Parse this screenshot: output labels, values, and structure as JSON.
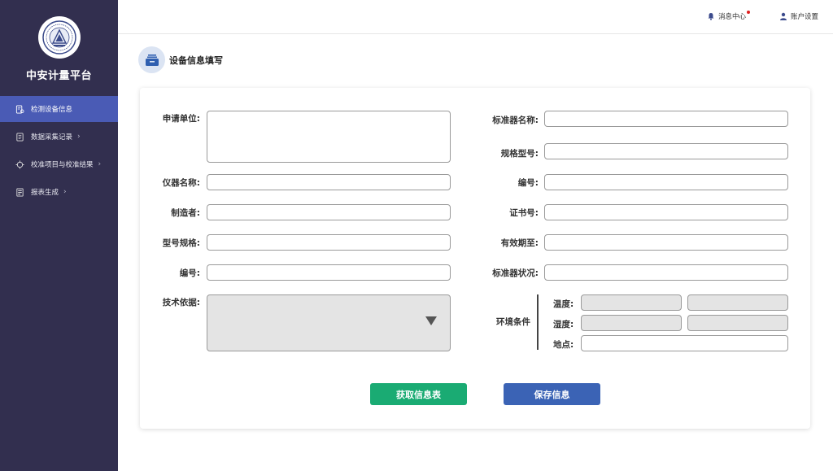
{
  "brand": {
    "name": "中安计量平台",
    "logo_icon": "metrology-seal-logo"
  },
  "sidebar": {
    "items": [
      {
        "label": "检测设备信息",
        "icon": "device-doc-icon",
        "active": true,
        "has_chevron": false
      },
      {
        "label": "数据采集记录",
        "icon": "notebook-icon",
        "active": false,
        "has_chevron": true
      },
      {
        "label": "校准项目与校准结果",
        "icon": "crosshair-icon",
        "active": false,
        "has_chevron": true
      },
      {
        "label": "报表生成",
        "icon": "report-icon",
        "active": false,
        "has_chevron": true
      }
    ],
    "chevron": "›"
  },
  "header": {
    "messages_label": "消息中心",
    "account_label": "账户设置",
    "has_unread": true
  },
  "page": {
    "title": "设备信息填写"
  },
  "form": {
    "left": {
      "applicant_label": "申请单位:",
      "instrument_label": "仪器名称:",
      "manufacturer_label": "制造者:",
      "model_label": "型号规格:",
      "serial_label": "编号:",
      "tech_basis_label": "技术依据:"
    },
    "right": {
      "standard_name_label": "标准器名称:",
      "spec_label": "规格型号:",
      "serial_label": "编号:",
      "cert_label": "证书号:",
      "valid_label": "有效期至:",
      "status_label": "标准器状况:",
      "env_label": "环境条件",
      "temp_label": "温度:",
      "humidity_label": "湿度:",
      "location_label": "地点:"
    }
  },
  "buttons": {
    "fetch": "获取信息表",
    "save": "保存信息"
  },
  "colors": {
    "sidebar": "#322f4f",
    "active": "#4a5bb5",
    "green": "#1aab73",
    "blue": "#3b63b5"
  }
}
